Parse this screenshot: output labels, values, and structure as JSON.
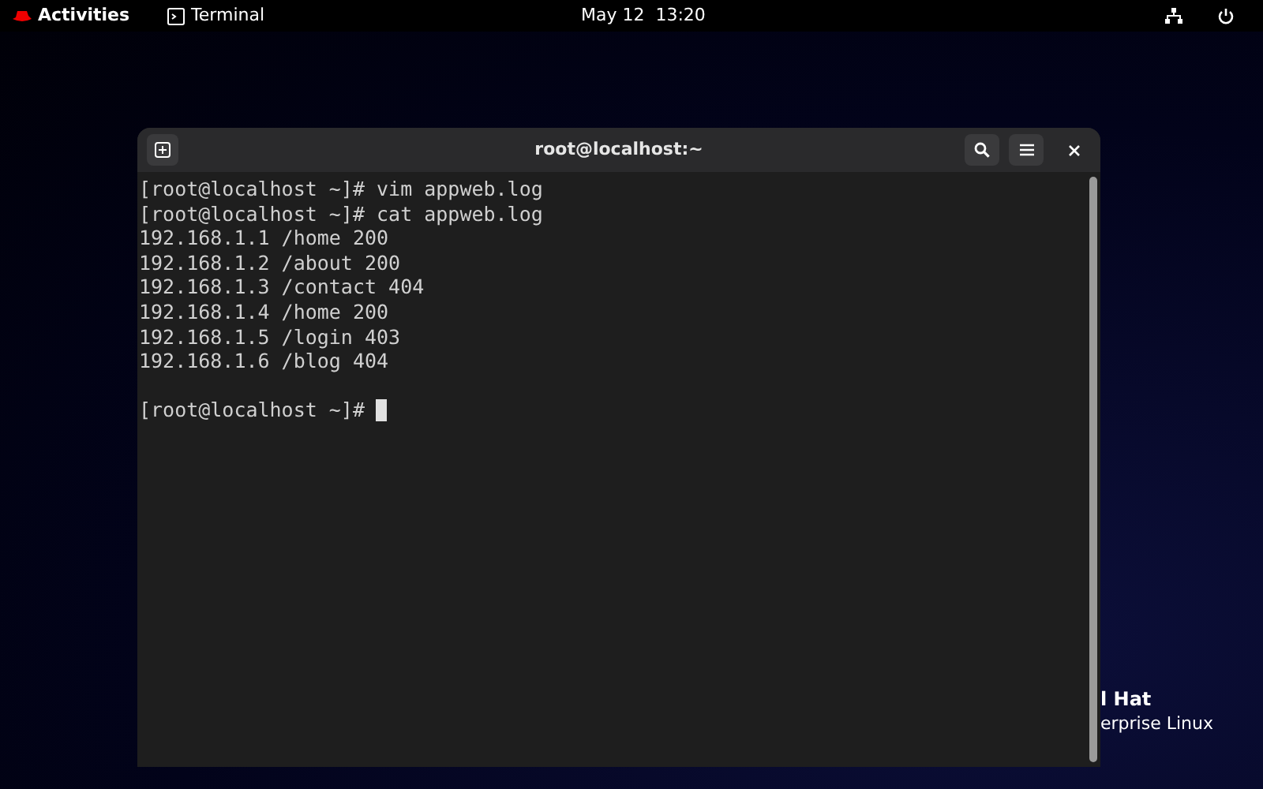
{
  "top_bar": {
    "activities": "Activities",
    "app_name": "Terminal",
    "clock": "May 12  13:20"
  },
  "desktop_logo": {
    "line_1": "l Hat",
    "line_2": "erprise Linux"
  },
  "window": {
    "title": "root@localhost:~",
    "lines": [
      "[root@localhost ~]# vim appweb.log",
      "[root@localhost ~]# cat appweb.log",
      "192.168.1.1 /home 200",
      "192.168.1.2 /about 200",
      "192.168.1.3 /contact 404",
      "192.168.1.4 /home 200",
      "192.168.1.5 /login 403",
      "192.168.1.6 /blog 404"
    ],
    "prompt": "[root@localhost ~]#"
  }
}
